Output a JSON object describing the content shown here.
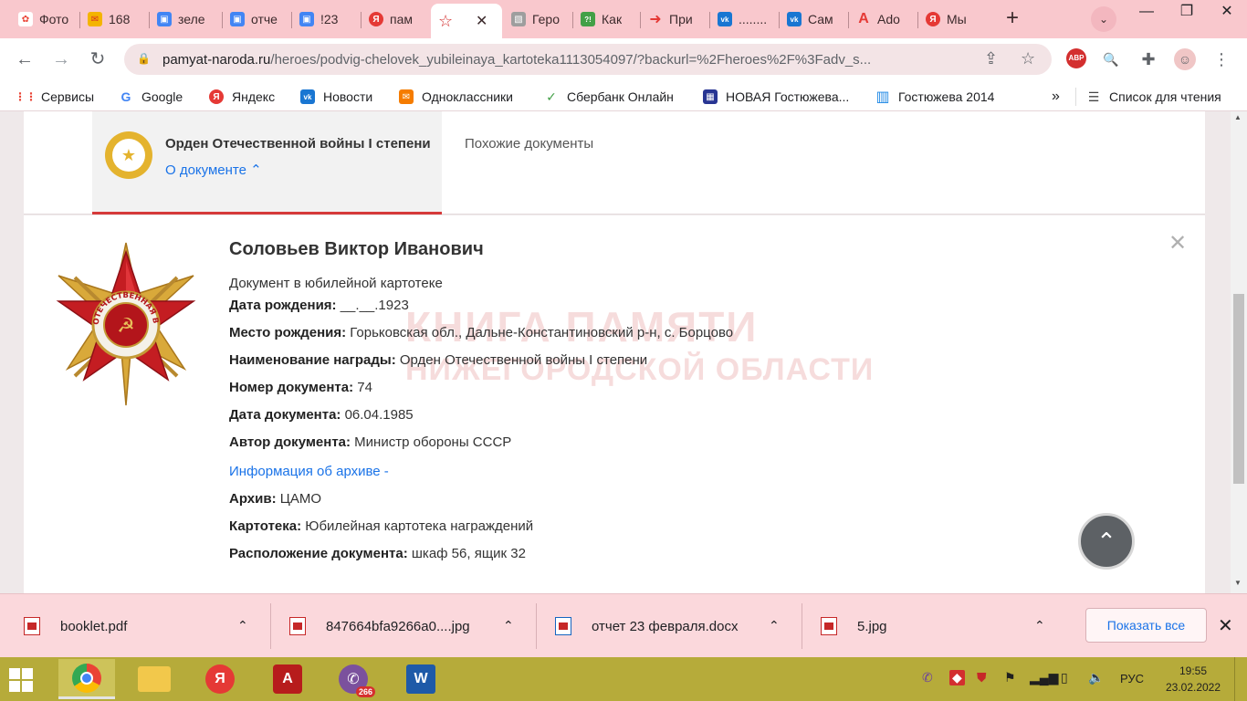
{
  "browser": {
    "tabs": [
      {
        "title": "Фото",
        "color": "#ea4335",
        "glyph": "✿"
      },
      {
        "title": "168",
        "color": "#d93025",
        "glyph": "✉"
      },
      {
        "title": "зеле",
        "color": "#4285f4",
        "glyph": "▣"
      },
      {
        "title": "отче",
        "color": "#4285f4",
        "glyph": "▣"
      },
      {
        "title": "!23",
        "color": "#4285f4",
        "glyph": "▣"
      },
      {
        "title": "пам",
        "color": "#e53935",
        "glyph": "Я"
      },
      {
        "title": "",
        "color": "#d32f2f",
        "glyph": "☆",
        "active": true
      },
      {
        "title": "Геро",
        "color": "#9e9e9e",
        "glyph": "▧"
      },
      {
        "title": "Как",
        "color": "#43a047",
        "glyph": "?!"
      },
      {
        "title": "При",
        "color": "#e53935",
        "glyph": "➜"
      },
      {
        "title": "........",
        "color": "#1976d2",
        "glyph": "vk"
      },
      {
        "title": "Сам",
        "color": "#1976d2",
        "glyph": "vk"
      },
      {
        "title": "Ado",
        "color": "#e53935",
        "glyph": "A"
      },
      {
        "title": "Мы",
        "color": "#e53935",
        "glyph": "Я"
      }
    ],
    "url_host": "pamyat-naroda.ru",
    "url_path": "/heroes/podvig-chelovek_yubileinaya_kartoteka1113054097/?backurl=%2Fheroes%2F%3Fadv_s...",
    "abp_label": "ABP",
    "bookmarks": [
      {
        "label": "Сервисы",
        "color": "#ea4335",
        "glyph": "⋮⋮"
      },
      {
        "label": "Google",
        "color": "#4285f4",
        "glyph": "G"
      },
      {
        "label": "Яндекс",
        "color": "#e53935",
        "glyph": "Я"
      },
      {
        "label": "Новости",
        "color": "#1976d2",
        "glyph": "vk"
      },
      {
        "label": "Одноклассники",
        "color": "#f57c00",
        "glyph": "✉"
      },
      {
        "label": "Сбербанк Онлайн",
        "color": "#43a047",
        "glyph": "✓"
      },
      {
        "label": "НОВАЯ Гостюжева...",
        "color": "#283593",
        "glyph": "▦"
      },
      {
        "label": "Гостюжева 2014",
        "color": "#1e88e5",
        "glyph": "▥"
      }
    ],
    "bookmarks_more": "»",
    "reading_list": "Список для чтения"
  },
  "page": {
    "award_tab_title": "Орден Отечественной войны I степени",
    "about_link": "О документе ⌃",
    "similar_docs": "Похожие документы",
    "person_name": "Соловьев Виктор Иванович",
    "doc_type": "Документ в юбилейной картотеке",
    "fields": [
      {
        "label": "Дата рождения:",
        "value": " __.__.1923"
      },
      {
        "label": "Место рождения:",
        "value": " Горьковская обл., Дальне-Константиновский р-н, с. Борцово"
      },
      {
        "label": "Наименование награды:",
        "value": " Орден Отечественной войны I степени"
      },
      {
        "label": "Номер документа:",
        "value": " 74"
      },
      {
        "label": "Дата документа:",
        "value": " 06.04.1985"
      },
      {
        "label": "Автор документа:",
        "value": " Министр обороны СССР"
      }
    ],
    "archive_link": "Информация об архиве -",
    "archive_fields": [
      {
        "label": "Архив:",
        "value": " ЦАМО"
      },
      {
        "label": "Картотека:",
        "value": " Юбилейная картотека награждений"
      },
      {
        "label": "Расположение документа:",
        "value": " шкаф 56, ящик 32"
      }
    ],
    "watermark_line1": "КНИГА ПАМЯТИ",
    "watermark_line2": "НИЖЕГОРОДСКОЙ ОБЛАСТИ",
    "order_ring_text": "ОТЕЧЕСТВЕННАЯ ВОЙНА"
  },
  "downloads": {
    "items": [
      "booklet.pdf",
      "847664bfa9266a0....jpg",
      "отчет 23 февраля.docx",
      "5.jpg"
    ],
    "show_all": "Показать все"
  },
  "taskbar": {
    "viber_badge": "266",
    "lang": "РУС",
    "time": "19:55",
    "date": "23.02.2022"
  }
}
